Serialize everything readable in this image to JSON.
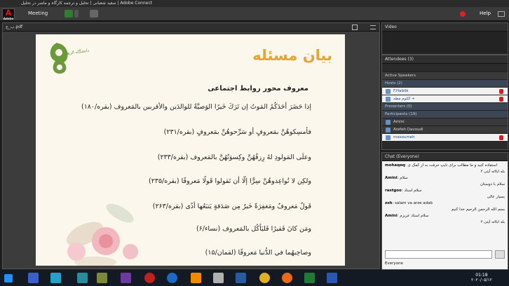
{
  "window": {
    "title": "سعید شعبانی | تحلیل و ترجمه کارگاه و ماضر در تحلیل | Adobe Connect"
  },
  "menu": {
    "meeting": "Meeting",
    "help": "Help"
  },
  "share_pod": {
    "file": "ب_ج.pdf"
  },
  "slide": {
    "title": "بیان مسئله",
    "subtitle": "معروف محور روابط اجتماعی",
    "lines": [
      "إذا حَضَرَ أحَدَكُمُ المَوتُ إن تَرَكَ خَيرًا الوَصيَّةُ للوالدَين والأقربين بالمَعروف (بقره/۱۸۰)",
      "فأمسِكوهُنَّ بمَعروفٍ أو سَرِّحوهُنَّ بمَعروفٍ (بقره/۲۳۱)",
      "وعلَى المَولودِ لهُ رِزقُهُنَّ وكِسوَتُهُنَّ بالمَعروف (بقره/۲۳۳)",
      "ولكِن لا تُواعِدوهُنَّ سِرًّا إلّا أن تَقولوا قَولًا مَعروفًا (بقره/۲۳۵)",
      "قَولٌ مَعروفٌ ومَغفِرَةٌ خَيرٌ مِن صَدَقةٍ يَتبَعُها أذًى (بقره/۲۶۳)",
      "ومَن كانَ فَقيرًا فَليَأكُل بالمَعروف (نساء/۶)",
      "وصاحِبهُما في الدُّنيا مَعروفًا (لقمان/۱۵)"
    ],
    "logo_text": "دانشگاه الزهرا"
  },
  "video_pod": {
    "title": "Video"
  },
  "attendees": {
    "title": "Attendees",
    "count": "(3)",
    "active_speakers": "Active Speakers",
    "hosts_label": "Hosts (2)",
    "hosts": [
      "F.Habibi",
      "کلثوم مطه +"
    ],
    "presenters_label": "Presenters (0)",
    "participants_label": "Participants (19)",
    "participants": [
      "Amini",
      "Arefeh Davoudi",
      "masoumeh"
    ]
  },
  "chat": {
    "title": "Chat",
    "scope": "(Everyone)",
    "messages": [
      {
        "who": "mohaqeq",
        "text": "استفاده کنید و ما مطالب برای تایپ حرفت به از کمک ی"
      },
      {
        "who": "",
        "text": "بله ابااته آیتی ۲"
      },
      {
        "who": "Amini",
        "text": "سلام"
      },
      {
        "who": "",
        "text": "سلام با دوستان"
      },
      {
        "who": "rastgoo",
        "text": "سلام استاد"
      },
      {
        "who": "",
        "text": "بسیار عالی"
      },
      {
        "who": "zsh",
        "text": "salam va arze adab"
      },
      {
        "who": "",
        "text": "بسم الله الرحمن الرحیم خدا کنیم"
      },
      {
        "who": "Amini",
        "text": "سلام استاد عزیزم"
      },
      {
        "who": "",
        "text": "بله ابااته آیتی ۲"
      }
    ],
    "to": "Everyone"
  },
  "taskbar": {
    "time": "01:18",
    "date": "۲۰۲۰/۰۵/۱۲"
  }
}
